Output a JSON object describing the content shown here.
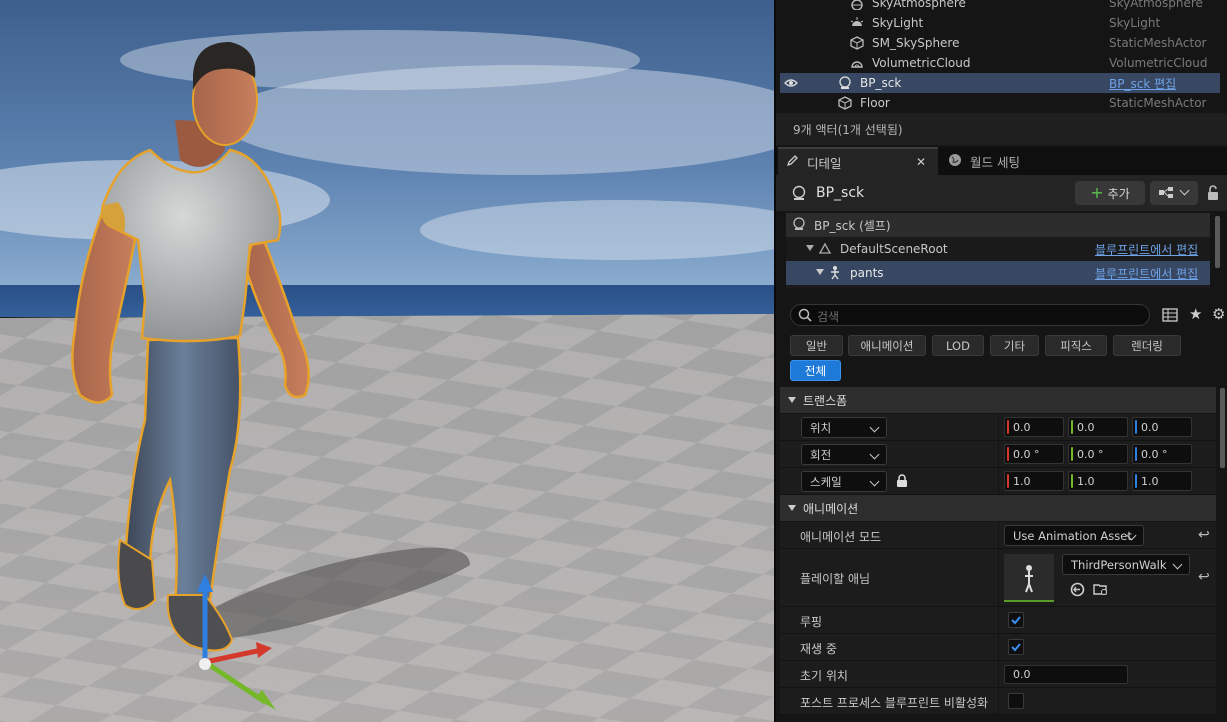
{
  "outliner": {
    "rows": [
      {
        "name": "SkyAtmosphere",
        "type": "SkyAtmosphere",
        "icon": "sky-atmosphere-icon"
      },
      {
        "name": "SkyLight",
        "type": "SkyLight",
        "icon": "skylight-icon"
      },
      {
        "name": "SM_SkySphere",
        "type": "StaticMeshActor",
        "icon": "static-mesh-icon"
      },
      {
        "name": "VolumetricCloud",
        "type": "VolumetricCloud",
        "icon": "cloud-icon"
      },
      {
        "name": "BP_sck",
        "type": "BP_sck 편집",
        "icon": "blueprint-actor-icon",
        "selected": true
      },
      {
        "name": "Floor",
        "type": "StaticMeshActor",
        "icon": "static-mesh-icon"
      }
    ],
    "actor_count": "9개 액터(1개 선택됨)"
  },
  "tabs": {
    "details": "디테일",
    "world_settings": "월드 세팅"
  },
  "details": {
    "selected_name": "BP_sck",
    "add_label": "추가",
    "components": [
      {
        "name": "BP_sck (셀프)"
      },
      {
        "name": "DefaultSceneRoot",
        "link": "블루프린트에서 편집"
      },
      {
        "name": "pants",
        "link": "블루프린트에서 편집"
      }
    ],
    "search_placeholder": "검색",
    "filters": [
      "일반",
      "애니메이션",
      "LOD",
      "기타",
      "피직스",
      "렌더링",
      "전체"
    ],
    "transform": {
      "title": "트랜스폼",
      "location_label": "위치",
      "rotation_label": "회전",
      "scale_label": "스케일",
      "location": [
        "0.0",
        "0.0",
        "0.0"
      ],
      "rotation": [
        "0.0 °",
        "0.0 °",
        "0.0 °"
      ],
      "scale": [
        "1.0",
        "1.0",
        "1.0"
      ]
    },
    "animation": {
      "title": "애니메이션",
      "mode_label": "애니메이션 모드",
      "mode_value": "Use Animation Asset",
      "play_anim_label": "플레이할 애님",
      "play_anim_value": "ThirdPersonWalk",
      "looping_label": "루핑",
      "playing_label": "재생 중",
      "initial_pos_label": "초기 위치",
      "initial_pos_value": "0.0",
      "post_process_label": "포스트 프로세스 블루프린트 비활성화",
      "looping": true,
      "playing": true,
      "post_process_disabled": false
    }
  },
  "colors": {
    "accent": "#1d7ad8",
    "selection": "#384863",
    "link": "#6ea3e8",
    "axis_x": "#d33a2c",
    "axis_y": "#76b82a",
    "axis_z": "#2f7fe0"
  }
}
